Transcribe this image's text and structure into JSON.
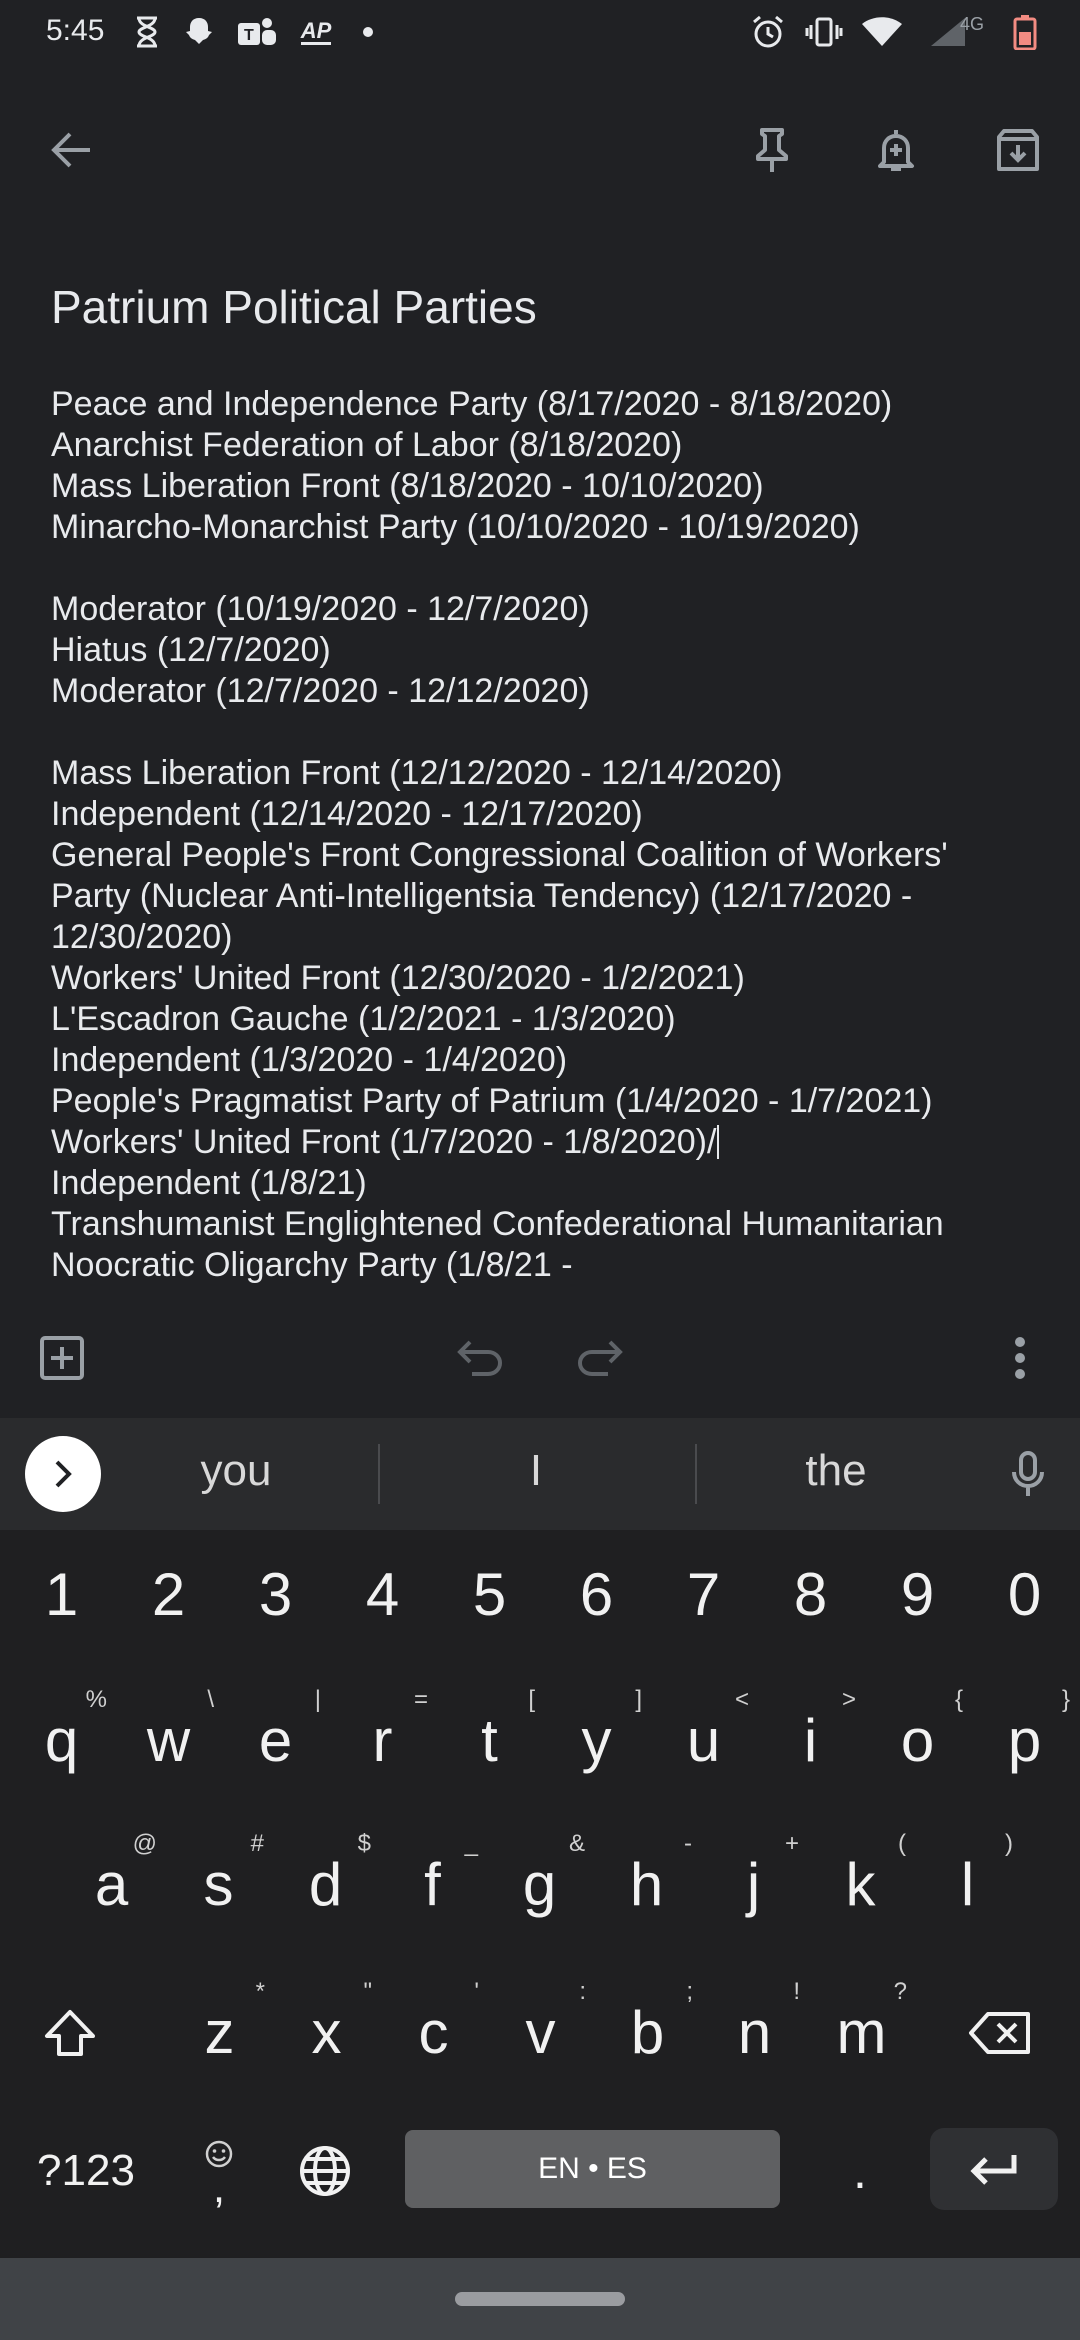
{
  "status_bar": {
    "time": "5:45",
    "left_icons": [
      "hourglass-icon",
      "snapchat-icon",
      "teams-icon",
      "ap-news-icon",
      "dot-icon"
    ],
    "ap_label": "AP",
    "network_label": "4G",
    "right_icons": [
      "alarm-icon",
      "vibrate-icon",
      "wifi-icon",
      "cell-signal-icon",
      "battery-icon"
    ],
    "battery_color": "#f28b82"
  },
  "toolbar": {
    "icons": [
      "back-arrow-icon",
      "pin-icon",
      "reminder-icon",
      "archive-icon"
    ]
  },
  "note": {
    "title": "Patrium Political Parties",
    "lines": [
      "Peace and Independence Party (8/17/2020 - 8/18/2020)",
      "Anarchist Federation of Labor (8/18/2020)",
      "Mass Liberation Front (8/18/2020 - 10/10/2020)",
      "Minarcho-Monarchist Party (10/10/2020 - 10/19/2020)",
      "",
      "Moderator (10/19/2020 - 12/7/2020)",
      "Hiatus (12/7/2020)",
      "Moderator (12/7/2020 - 12/12/2020)",
      "",
      "Mass Liberation Front (12/12/2020 - 12/14/2020)",
      "Independent (12/14/2020 - 12/17/2020)",
      "General People's Front Congressional Coalition of Workers'",
      "Party (Nuclear Anti-Intelligentsia Tendency) (12/17/2020 -",
      "12/30/2020)",
      "Workers' United Front (12/30/2020 - 1/2/2021)",
      "L'Escadron Gauche (1/2/2021 - 1/3/2020)",
      "Independent (1/3/2020 - 1/4/2020)",
      "People's Pragmatist Party of Patrium (1/4/2020 - 1/7/2021)",
      "Workers' United Front (1/7/2020 - 1/8/2020)/",
      "Independent (1/8/21)",
      "Transhumanist Englightened Confederational Humanitarian",
      "Noocratic Oligarchy Party (1/8/21 -"
    ],
    "caret_line_index": 18
  },
  "editor_bar": {
    "icons": [
      "add-box-icon",
      "undo-icon",
      "redo-icon",
      "more-vert-icon"
    ]
  },
  "keyboard": {
    "suggestions": [
      "you",
      "I",
      "the"
    ],
    "number_row": [
      "1",
      "2",
      "3",
      "4",
      "5",
      "6",
      "7",
      "8",
      "9",
      "0"
    ],
    "row1": [
      {
        "key": "q",
        "hint": "%"
      },
      {
        "key": "w",
        "hint": "\\"
      },
      {
        "key": "e",
        "hint": "|"
      },
      {
        "key": "r",
        "hint": "="
      },
      {
        "key": "t",
        "hint": "["
      },
      {
        "key": "y",
        "hint": "]"
      },
      {
        "key": "u",
        "hint": "<"
      },
      {
        "key": "i",
        "hint": ">"
      },
      {
        "key": "o",
        "hint": "{"
      },
      {
        "key": "p",
        "hint": "}"
      }
    ],
    "row2": [
      {
        "key": "a",
        "hint": "@"
      },
      {
        "key": "s",
        "hint": "#"
      },
      {
        "key": "d",
        "hint": "$"
      },
      {
        "key": "f",
        "hint": "_"
      },
      {
        "key": "g",
        "hint": "&"
      },
      {
        "key": "h",
        "hint": "-"
      },
      {
        "key": "j",
        "hint": "+"
      },
      {
        "key": "k",
        "hint": "("
      },
      {
        "key": "l",
        "hint": ")"
      }
    ],
    "row3": [
      {
        "key": "z",
        "hint": "*"
      },
      {
        "key": "x",
        "hint": "\""
      },
      {
        "key": "c",
        "hint": "'"
      },
      {
        "key": "v",
        "hint": ":"
      },
      {
        "key": "b",
        "hint": ";"
      },
      {
        "key": "n",
        "hint": "!"
      },
      {
        "key": "m",
        "hint": "?"
      }
    ],
    "symbols_label": "?123",
    "comma_label": ",",
    "space_label": "EN • ES",
    "period_label": "."
  }
}
